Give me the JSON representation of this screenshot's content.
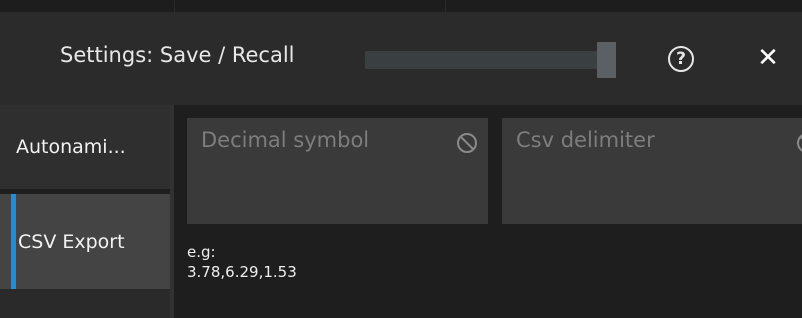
{
  "dialog": {
    "title": "Settings: Save / Recall",
    "help_icon": "help-circle-icon",
    "help_glyph": "?",
    "close_icon": "close-icon",
    "close_glyph": "✕"
  },
  "tabs": [
    {
      "label": "Autonami...",
      "active": false
    },
    {
      "label": "CSV Export",
      "active": true
    }
  ],
  "fields": {
    "decimal_symbol": {
      "label": "Decimal symbol",
      "icon": "disabled-icon"
    },
    "csv_delimiter": {
      "label": "Csv delimiter",
      "icon": "disabled-icon"
    }
  },
  "example": {
    "prefix": "e.g:",
    "value": "3.78,6.29,1.53"
  },
  "colors": {
    "accent": "#1e8ddc",
    "background": "#1e1e1e",
    "field": "#3a3a3a"
  }
}
